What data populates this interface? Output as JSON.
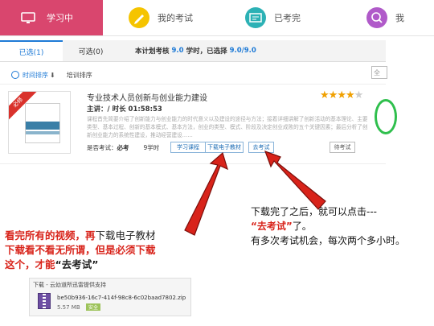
{
  "tabs": [
    {
      "label": "学习中",
      "icon": "monitor-icon"
    },
    {
      "label": "我的考试",
      "icon": "pencil-icon"
    },
    {
      "label": "已考完",
      "icon": "certificate-icon"
    },
    {
      "label": "我",
      "icon": "search-icon"
    }
  ],
  "subtabs": {
    "selected": "已选(1)",
    "optional": "可选(0)"
  },
  "plan": {
    "prefix": "本计划考核",
    "required": "9.0",
    "mid": "学时，已选择",
    "chosen": "9.0/9.0"
  },
  "sort": {
    "time": "时间排序",
    "arrow": "⬇",
    "category": "培训排序"
  },
  "search": {
    "text": "全"
  },
  "course": {
    "ribbon": "必修",
    "title": "专业技术人员创新与创业能力建设",
    "meta": "主讲：/ 时长 01:58:53",
    "desc": "课程首先简要介绍了创新能力与创业能力的时代意义以及建设的途径与方法；接着详细讲解了创新活动的基本理论、主要类型、基本过程、创新的基本模式、基本方法，创业的类型、模式、阶段及决定创业成败的五个关键因素；最后分析了创新创业能力的系统性建设，推动经营建设……",
    "exam_label": "是否考试：",
    "exam_value": "必考",
    "hours": "9学时",
    "rating": 4,
    "rating_max": 5
  },
  "buttons": {
    "learn": "学习课程",
    "download": "下载电子教材",
    "exam": "去考试",
    "status": "待考试"
  },
  "annotation_left": [
    [
      {
        "t": "看完所有的视频，再",
        "c": "red"
      },
      {
        "t": "下载电子教材",
        "c": "dark"
      }
    ],
    [
      {
        "t": "下载看不看无所谓，但是必须下载",
        "c": "red"
      }
    ],
    [
      {
        "t": "这个，才能",
        "c": "red"
      },
      {
        "t": "“去考试”",
        "c": "dark"
      }
    ]
  ],
  "annotation_right": {
    "line1": "下载完了之后，就可以点击---",
    "quote": "“去考试”",
    "line2_tail": "了。",
    "line3": "有多次考试机会，每次两个多小时。"
  },
  "download": {
    "header": "下载 - 云幼道所迅雷提供支持",
    "filename": "be50b936-16c7-414f-98c8-6c02baad7802.zip",
    "size": "5.57 MB",
    "badge": "安全"
  },
  "colors": {
    "accent": "#d9466e",
    "link": "#1e7ad6",
    "annotation": "#d8231a"
  }
}
